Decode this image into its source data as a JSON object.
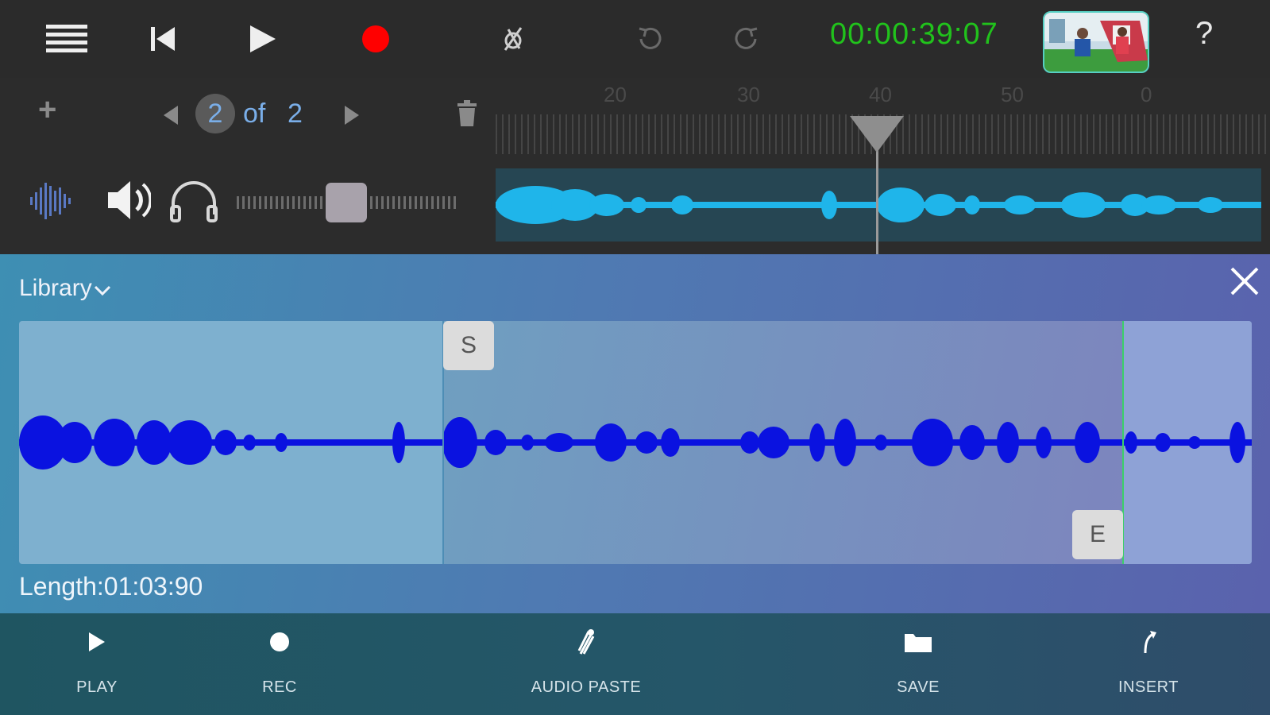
{
  "toolbar": {
    "timecode": "00:00:39:07",
    "help_label": "?",
    "icons": [
      "menu-icon",
      "skip-back-icon",
      "play-icon",
      "record-icon",
      "metronome-icon",
      "undo-icon",
      "redo-icon"
    ],
    "record_color": "#ff0000",
    "timecode_color": "#21c21c"
  },
  "tracks": {
    "add_label": "+",
    "current_page": "2",
    "of_label": "of",
    "total_pages": "2",
    "volume_level": 0.64
  },
  "ruler": {
    "labels": [
      "20",
      "30",
      "40",
      "50",
      "0"
    ]
  },
  "library": {
    "title": "Library",
    "start_marker": "S",
    "end_marker": "E",
    "length_text": "Length:01:03:90",
    "selection_start_fraction": 0.344,
    "selection_end_fraction": 0.895
  },
  "bottom": {
    "play_label": "PLAY",
    "rec_label": "REC",
    "audio_paste_label": "AUDIO PASTE",
    "save_label": "SAVE",
    "insert_label": "INSERT"
  },
  "colors": {
    "track_wave": "#1fb5ea",
    "library_wave": "#0a12e0",
    "end_marker_line": "#3ccf6a"
  }
}
